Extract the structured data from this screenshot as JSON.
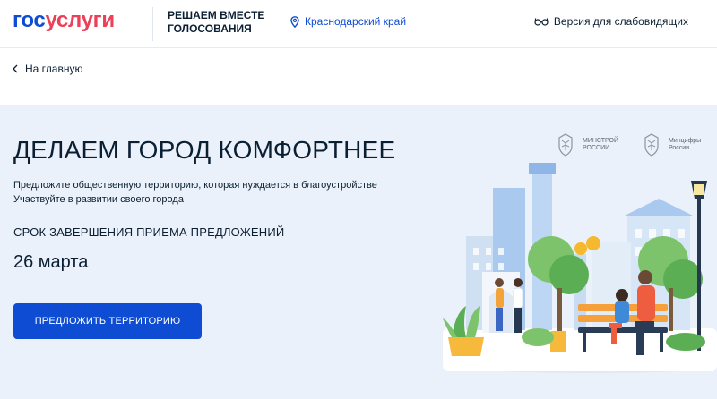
{
  "header": {
    "logo_part1": "гос",
    "logo_part2": "услуги",
    "project_line1": "РЕШАЕМ ВМЕСТЕ",
    "project_line2": "ГОЛОСОВАНИЯ",
    "region": "Краснодарский край",
    "accessibility": "Версия для слабовидящих"
  },
  "breadcrumb": {
    "back_label": "На главную"
  },
  "hero": {
    "title": "ДЕЛАЕМ ГОРОД КОМФОРТНЕЕ",
    "desc_line1": "Предложите общественную территорию, которая нуждается в благоустройстве",
    "desc_line2": "Участвуйте в развитии своего города",
    "deadline_label": "СРОК ЗАВЕРШЕНИЯ ПРИЕМА ПРЕДЛОЖЕНИЙ",
    "deadline_date": "26 марта",
    "cta_label": "ПРЕДЛОЖИТЬ ТЕРРИТОРИЮ"
  },
  "partners": {
    "minstroy_line1": "МИНСТРОЙ",
    "minstroy_line2": "РОССИИ",
    "mintsifry_line1": "Минцифры",
    "mintsifry_line2": "России"
  },
  "colors": {
    "brand_blue": "#0d4cd3",
    "brand_red": "#ee3f58",
    "hero_bg": "#eaf1fa"
  }
}
